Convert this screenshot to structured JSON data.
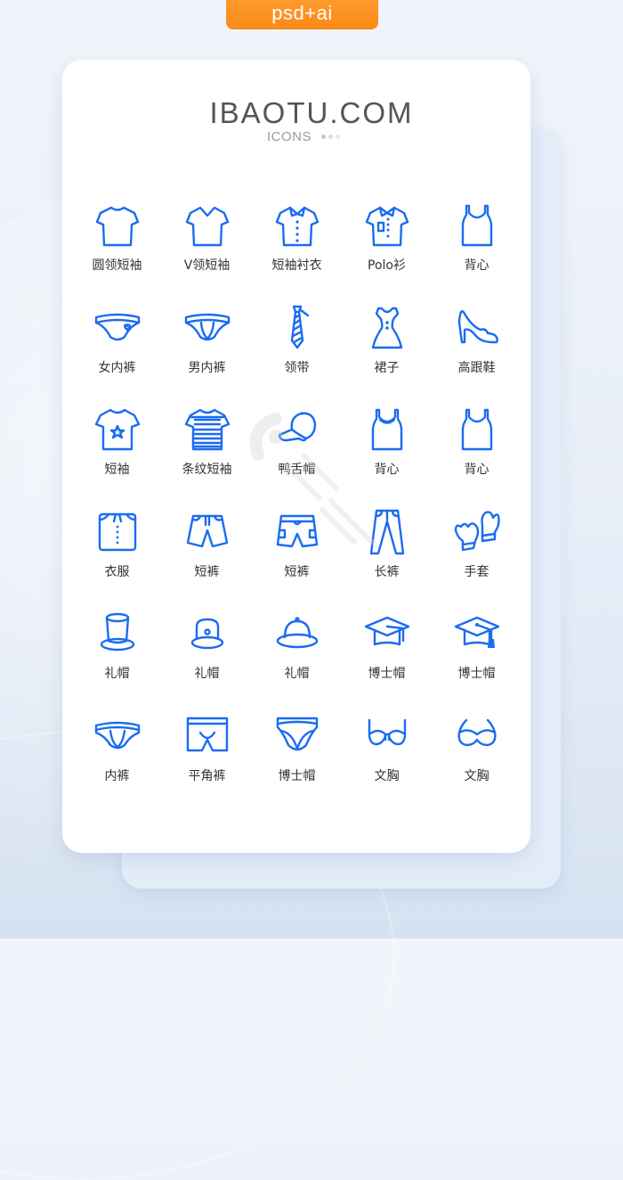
{
  "badge": {
    "label": "psd+ai"
  },
  "header": {
    "brand": "IBAOTU.COM",
    "subtitle": "ICONS"
  },
  "colors": {
    "icon_stroke": "#1a6cf0",
    "badge": "#fb8a16",
    "brand_text": "#555555"
  },
  "icons": [
    {
      "icon": "round-neck-tshirt-icon",
      "label": "圆领短袖"
    },
    {
      "icon": "v-neck-tshirt-icon",
      "label": "V领短袖"
    },
    {
      "icon": "short-sleeve-shirt-icon",
      "label": "短袖衬衣"
    },
    {
      "icon": "polo-shirt-icon",
      "label": "Polo衫"
    },
    {
      "icon": "tank-top-icon",
      "label": "背心"
    },
    {
      "icon": "womens-panties-icon",
      "label": "女内裤"
    },
    {
      "icon": "mens-briefs-icon",
      "label": "男内裤"
    },
    {
      "icon": "necktie-icon",
      "label": "领带"
    },
    {
      "icon": "dress-icon",
      "label": "裙子"
    },
    {
      "icon": "high-heel-icon",
      "label": "高跟鞋"
    },
    {
      "icon": "star-tshirt-icon",
      "label": "短袖"
    },
    {
      "icon": "striped-tshirt-icon",
      "label": "条纹短袖"
    },
    {
      "icon": "baseball-cap-icon",
      "label": "鸭舌帽"
    },
    {
      "icon": "tank-top-icon",
      "label": "背心"
    },
    {
      "icon": "tank-top-icon",
      "label": "背心"
    },
    {
      "icon": "folded-clothes-icon",
      "label": "衣服"
    },
    {
      "icon": "shorts-icon",
      "label": "短裤"
    },
    {
      "icon": "cargo-shorts-icon",
      "label": "短裤"
    },
    {
      "icon": "trousers-icon",
      "label": "长裤"
    },
    {
      "icon": "mittens-icon",
      "label": "手套"
    },
    {
      "icon": "top-hat-icon",
      "label": "礼帽"
    },
    {
      "icon": "bowler-hat-icon",
      "label": "礼帽"
    },
    {
      "icon": "sun-hat-icon",
      "label": "礼帽"
    },
    {
      "icon": "graduation-cap-icon",
      "label": "博士帽"
    },
    {
      "icon": "graduation-cap-tassel-icon",
      "label": "博士帽"
    },
    {
      "icon": "briefs-icon",
      "label": "内裤"
    },
    {
      "icon": "boxer-shorts-icon",
      "label": "平角裤"
    },
    {
      "icon": "panties-icon",
      "label": "博士帽"
    },
    {
      "icon": "bra-icon",
      "label": "文胸"
    },
    {
      "icon": "bra-alt-icon",
      "label": "文胸"
    }
  ]
}
